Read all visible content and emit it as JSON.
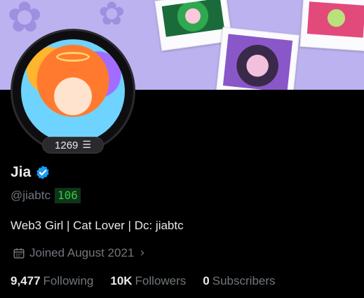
{
  "profile": {
    "badge_count": "1269",
    "name": "Jia",
    "handle": "@jiabtc",
    "handle_badge": "106",
    "bio": "Web3 Girl | Cat Lover | Dc: jiabtc",
    "joined": "Joined August 2021"
  },
  "stats": [
    {
      "value": "9,477",
      "label": "Following"
    },
    {
      "value": "10K",
      "label": "Followers"
    },
    {
      "value": "0",
      "label": "Subscribers"
    }
  ],
  "colors": {
    "banner": "#bdb2f0",
    "verified": "#1d9bf0",
    "muted_text": "#71767b",
    "badge_green": "#2ecc40"
  },
  "icons": {
    "verified": "verified-badge-icon",
    "badge_glyph": "levels-icon",
    "calendar": "calendar-icon",
    "chevron": "chevron-right-icon"
  }
}
